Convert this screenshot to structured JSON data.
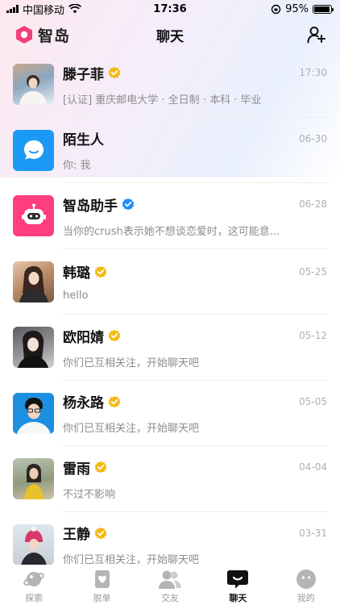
{
  "status_bar": {
    "carrier": "中国移动",
    "time": "17:36",
    "battery": "95%",
    "battery_level": 0.95
  },
  "header": {
    "brand": "智岛",
    "title": "聊天",
    "add_friend_icon": "add-user-icon"
  },
  "colors": {
    "verified_gold": "#f5b914",
    "verified_blue": "#1e90f5",
    "brand_pink": "#f0407a",
    "assistant_pink": "#ff3d7f",
    "stranger_blue": "#1b9af5",
    "tab_active": "#111111",
    "tab_inactive": "#b5b5b5"
  },
  "chats": [
    {
      "name": "滕子菲",
      "badge": "gold",
      "time": "17:30",
      "preview": "[认证] 重庆邮电大学 · 全日制 · 本科 · 毕业",
      "avatar": "photo"
    },
    {
      "name": "陌生人",
      "badge": "",
      "time": "06-30",
      "preview": "你: 我",
      "avatar": "chat-bubble-icon"
    },
    {
      "name": "智岛助手",
      "badge": "blue",
      "time": "06-28",
      "preview": "当你的crush表示她不想谈恋爱时，这可能意...",
      "avatar": "robot-icon"
    },
    {
      "name": "韩璐",
      "badge": "gold",
      "time": "05-25",
      "preview": "hello",
      "avatar": "photo"
    },
    {
      "name": "欧阳婧",
      "badge": "gold",
      "time": "05-12",
      "preview": "你们已互相关注，开始聊天吧",
      "avatar": "photo"
    },
    {
      "name": "杨永路",
      "badge": "gold",
      "time": "05-05",
      "preview": "你们已互相关注，开始聊天吧",
      "avatar": "photo"
    },
    {
      "name": "雷雨",
      "badge": "gold",
      "time": "04-04",
      "preview": "不过不影响",
      "avatar": "photo"
    },
    {
      "name": "王静",
      "badge": "gold",
      "time": "03-31",
      "preview": "你们已互相关注，开始聊天吧",
      "avatar": "photo"
    }
  ],
  "tabs": [
    {
      "label": "探索",
      "icon": "planet-icon",
      "active": false
    },
    {
      "label": "脱单",
      "icon": "heart-card-icon",
      "active": false
    },
    {
      "label": "交友",
      "icon": "friends-icon",
      "active": false
    },
    {
      "label": "聊天",
      "icon": "chat-icon",
      "active": true
    },
    {
      "label": "我的",
      "icon": "profile-icon",
      "active": false
    }
  ]
}
